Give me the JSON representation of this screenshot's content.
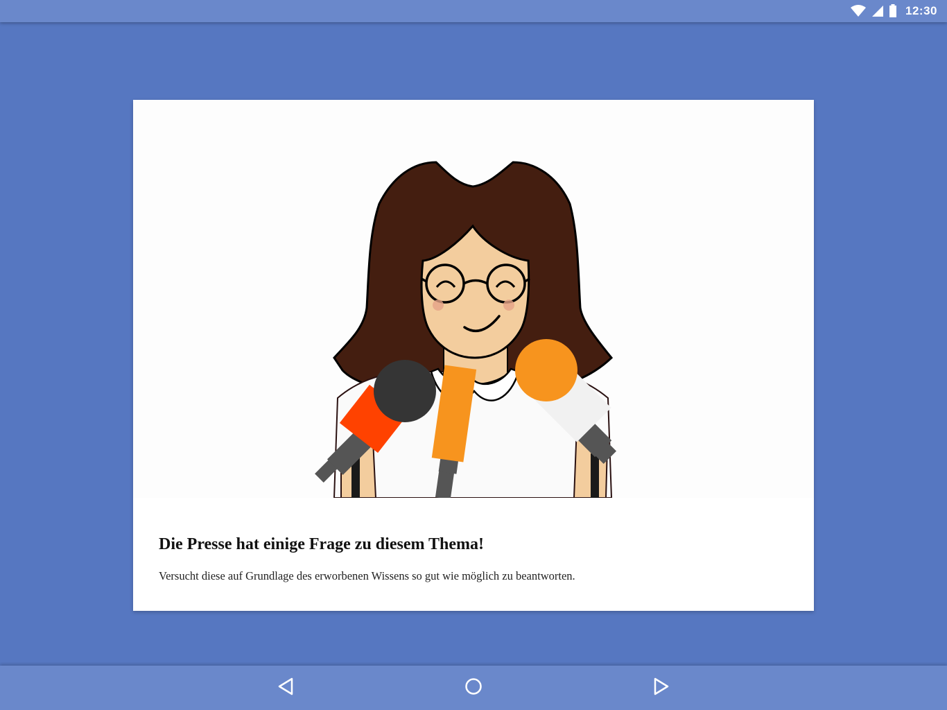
{
  "status_bar": {
    "time": "12:30",
    "icons": [
      "wifi-icon",
      "cellular-signal-icon",
      "battery-icon"
    ]
  },
  "card": {
    "illustration": "smiling-girl-with-microphones",
    "title": "Die Presse hat einige Frage zu diesem Thema!",
    "text": "Versucht diese auf Grundlage des erworbenen Wissens so gut wie möglich zu beantworten."
  },
  "nav_bar": {
    "buttons": [
      "back-icon",
      "home-icon",
      "next-icon"
    ]
  },
  "colors": {
    "background": "#5677c1",
    "bars": "#6a88cb",
    "card": "#ffffff",
    "hair": "#441e10",
    "skin": "#f3cd9e",
    "mic_red": "#ff4200",
    "mic_orange": "#f7941e",
    "mic_dark": "#353535"
  }
}
